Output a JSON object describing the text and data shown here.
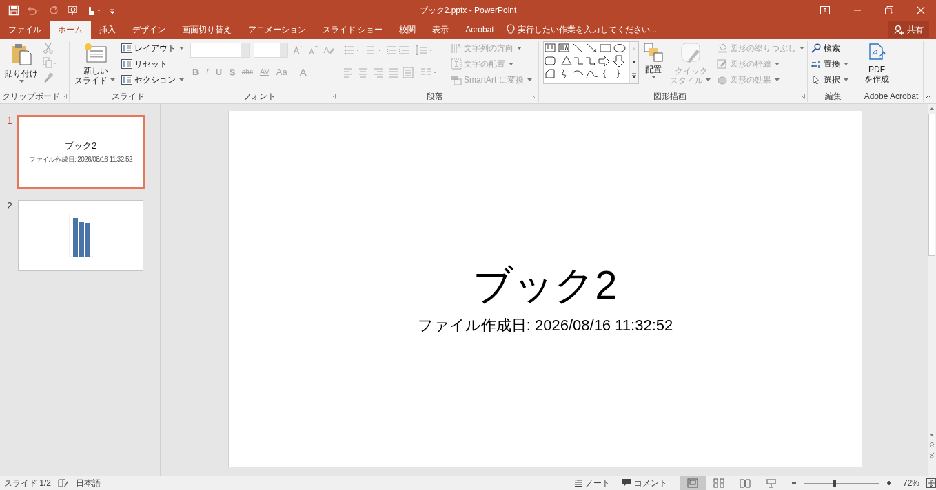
{
  "window": {
    "title": "ブック2.pptx - PowerPoint"
  },
  "tabs": [
    {
      "label": "ファイル",
      "selected": false
    },
    {
      "label": "ホーム",
      "selected": true
    },
    {
      "label": "挿入",
      "selected": false
    },
    {
      "label": "デザイン",
      "selected": false
    },
    {
      "label": "画面切り替え",
      "selected": false
    },
    {
      "label": "アニメーション",
      "selected": false
    },
    {
      "label": "スライド ショー",
      "selected": false
    },
    {
      "label": "校閲",
      "selected": false
    },
    {
      "label": "表示",
      "selected": false
    },
    {
      "label": "Acrobat",
      "selected": false
    }
  ],
  "tell_me": {
    "placeholder": "実行したい作業を入力してください..."
  },
  "share_button": {
    "label": "共有"
  },
  "ribbon": {
    "clipboard": {
      "label": "クリップボード",
      "paste": {
        "label": "貼り付け",
        "disabled": false
      }
    },
    "slides": {
      "label": "スライド",
      "new_slide": {
        "lines": [
          "新しい",
          "スライド"
        ],
        "disabled": false
      },
      "commands": [
        {
          "label": "レイアウト",
          "disabled": false
        },
        {
          "label": "リセット",
          "disabled": false
        },
        {
          "label": "セクション",
          "disabled": false
        }
      ]
    },
    "font": {
      "label": "フォント",
      "format_buttons": [
        {
          "label": "B",
          "disabled": true
        },
        {
          "label": "I",
          "disabled": true
        },
        {
          "label": "U",
          "disabled": true
        },
        {
          "label": "S",
          "disabled": true
        },
        {
          "label": "abc",
          "disabled": true
        },
        {
          "label": "AV",
          "disabled": true
        },
        {
          "label": "Aa",
          "disabled": true
        },
        {
          "label": "A",
          "disabled": true
        }
      ]
    },
    "paragraph": {
      "label": "段落",
      "commands": [
        {
          "label": "文字列の方向",
          "disabled": true
        },
        {
          "label": "文字の配置",
          "disabled": true
        },
        {
          "label": "SmartArt に変換",
          "disabled": true
        }
      ]
    },
    "drawing": {
      "label": "図形描画",
      "arrange": {
        "label": "配置",
        "disabled": false
      },
      "quick_styles": {
        "lines": [
          "クイック",
          "スタイル"
        ],
        "disabled": true
      },
      "commands": [
        {
          "label": "図形の塗りつぶし",
          "disabled": true
        },
        {
          "label": "図形の枠線",
          "disabled": true
        },
        {
          "label": "図形の効果",
          "disabled": true
        }
      ]
    },
    "editing": {
      "label": "編集",
      "commands": [
        {
          "label": "検索",
          "disabled": false
        },
        {
          "label": "置換",
          "disabled": false
        },
        {
          "label": "選択",
          "disabled": false
        }
      ]
    },
    "acrobat": {
      "label": "Adobe Acrobat",
      "create_pdf": {
        "lines": [
          "PDF",
          "を作成"
        ],
        "disabled": false
      }
    }
  },
  "slides": [
    {
      "number": "1",
      "selected": true,
      "kind": "title",
      "title": "ブック2",
      "subtitle": "ファイル作成日: 2026/08/16 11:32:52"
    },
    {
      "number": "2",
      "selected": false,
      "kind": "chart"
    }
  ],
  "slide": {
    "title": "ブック2",
    "subtitle": "ファイル作成日: 2026/08/16 11:32:52"
  },
  "status_bar": {
    "slide_indicator": "スライド 1/2",
    "language": "日本語",
    "notes": "ノート",
    "comments": "コメント",
    "views": [
      {
        "selected": true
      },
      {
        "selected": false
      },
      {
        "selected": false
      },
      {
        "selected": false
      }
    ],
    "zoom": {
      "level": 0.41,
      "reading": "72%"
    }
  }
}
